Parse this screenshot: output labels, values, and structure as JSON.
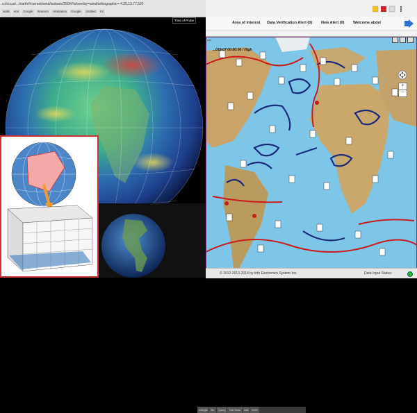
{
  "left_window": {
    "url": "s://cccur/.../earth/#current/wind/isobaric/250hPa/overlay=wind/orthographic=-4.25,13.77,520",
    "bookmarks": [
      "walls",
      "ecs",
      "Google",
      "Imareon",
      "Animation",
      "Google",
      "Untitled",
      "Int"
    ],
    "globe_tooltip": "Time of Probe"
  },
  "inset_globe": {
    "tabs": [
      "webgis",
      "file",
      "Query",
      "Tab Sess",
      "inst",
      "SOS"
    ]
  },
  "app": {
    "nav": {
      "area_of_interest": "Area of interest",
      "data_verification": "Data Verification Alert (0)",
      "new_alert": "New Alert (0)",
      "welcome": "Welcome abdel"
    },
    "map": {
      "selector": "",
      "timestamp": "...018-07 00:00:00 / High",
      "zoom_in": "+",
      "zoom_out": "−"
    },
    "footer": {
      "copyright": "© 2012-2013-2014 by Info Electronics System Inc.",
      "status_label": "Data Input Status:"
    }
  },
  "colors": {
    "ocean": "#7ec6e8",
    "land": "#c9a46a",
    "front_cold": "#1a2a7a",
    "front_warm": "#cc1a1a",
    "status_ok": "#2db52d"
  }
}
